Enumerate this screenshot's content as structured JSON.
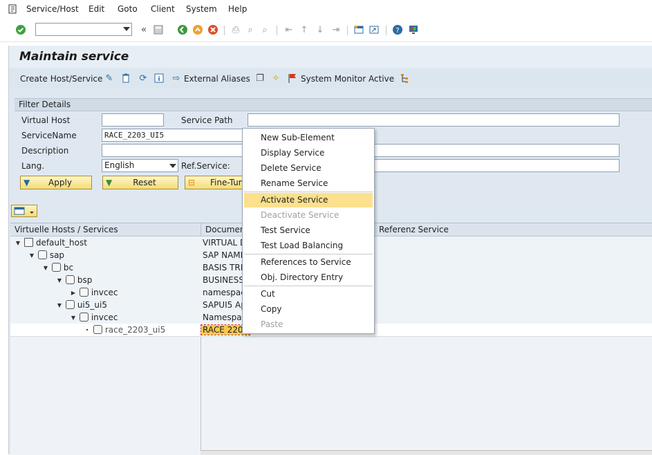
{
  "menubar": {
    "items": [
      "Service/Host",
      "Edit",
      "Goto",
      "Client",
      "System",
      "Help"
    ]
  },
  "toolbar": {
    "command_field_value": "",
    "icons": [
      "enter-check-icon",
      "save-icon",
      "back-icon",
      "exit-icon",
      "cancel-icon",
      "print-icon",
      "find-icon",
      "find-next-icon",
      "first-page-icon",
      "prev-page-icon",
      "next-page-icon",
      "last-page-icon",
      "new-session-icon",
      "shortcut-icon",
      "help-icon",
      "customize-layout-icon"
    ]
  },
  "title": "Maintain service",
  "app_toolbar": {
    "create_host_service": "Create Host/Service",
    "external_aliases": "External Aliases",
    "system_monitor_active": "System Monitor Active"
  },
  "filter": {
    "header": "Filter Details",
    "virtual_host_label": "Virtual Host",
    "virtual_host_value": "",
    "service_path_label": "Service Path",
    "service_path_value": "",
    "service_name_label": "ServiceName",
    "service_name_value": "RACE_2203_UI5",
    "description_label": "Description",
    "description_value": "",
    "lang_label": "Lang.",
    "lang_value": "English",
    "ref_service_label": "Ref.Service:",
    "ref_service_value": "",
    "apply": "Apply",
    "reset": "Reset",
    "fine_tune": "Fine-Tun"
  },
  "grid": {
    "columns": [
      "Virtuelle Hosts / Services",
      "Documen",
      "Referenz Service"
    ],
    "rows": [
      {
        "name": "default_host",
        "doc": "VIRTUAL D"
      },
      {
        "name": "sap",
        "doc": "SAP NAME"
      },
      {
        "name": "bc",
        "doc": "BASIS TRE"
      },
      {
        "name": "bsp",
        "doc": "BUSINESS"
      },
      {
        "name": "invcec",
        "doc": "namespac"
      },
      {
        "name": "ui5_ui5",
        "doc": "SAPUI5 Ap"
      },
      {
        "name": "invcec",
        "doc": "Namespac"
      },
      {
        "name": "race_2203_ui5",
        "doc": "RACE 2203"
      }
    ]
  },
  "context_menu": {
    "items": [
      {
        "label": "New Sub-Element",
        "state": "normal"
      },
      {
        "label": "Display Service",
        "state": "normal"
      },
      {
        "label": "Delete Service",
        "state": "normal"
      },
      {
        "label": "Rename Service",
        "state": "normal"
      },
      {
        "label": "Activate Service",
        "state": "highlighted"
      },
      {
        "label": "Deactivate Service",
        "state": "disabled"
      },
      {
        "label": "Test Service",
        "state": "normal"
      },
      {
        "label": "Test Load Balancing",
        "state": "normal"
      },
      {
        "label": "References to Service",
        "state": "normal"
      },
      {
        "label": "Obj. Directory Entry",
        "state": "normal"
      },
      {
        "label": "Cut",
        "state": "normal"
      },
      {
        "label": "Copy",
        "state": "normal"
      },
      {
        "label": "Paste",
        "state": "disabled"
      }
    ]
  },
  "colors": {
    "workarea_bg": "#dfe8f1",
    "highlight": "#fbe08e",
    "button_gold": "#f5dc78"
  }
}
